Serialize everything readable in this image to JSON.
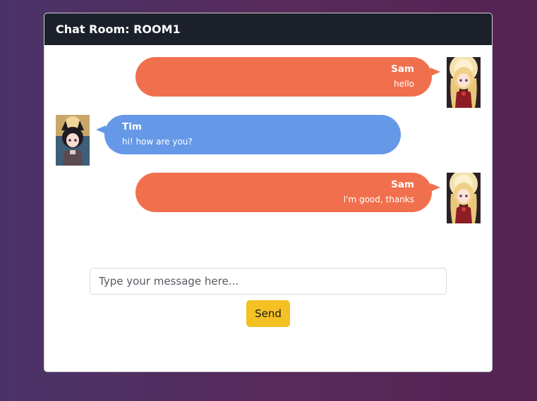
{
  "chat": {
    "title": "Chat Room: ROOM1",
    "messages": [
      {
        "sender": "Sam",
        "text": "hello",
        "side": "right"
      },
      {
        "sender": "Tim",
        "text": "hi! how are you?",
        "side": "left"
      },
      {
        "sender": "Sam",
        "text": "I'm good, thanks",
        "side": "right"
      }
    ]
  },
  "composer": {
    "placeholder": "Type your message here...",
    "value": "",
    "send_label": "Send"
  },
  "colors": {
    "header_bg": "#1c202a",
    "sam_bubble": "#f0704e",
    "tim_bubble": "#6698e8",
    "send_button": "#f5c024"
  }
}
